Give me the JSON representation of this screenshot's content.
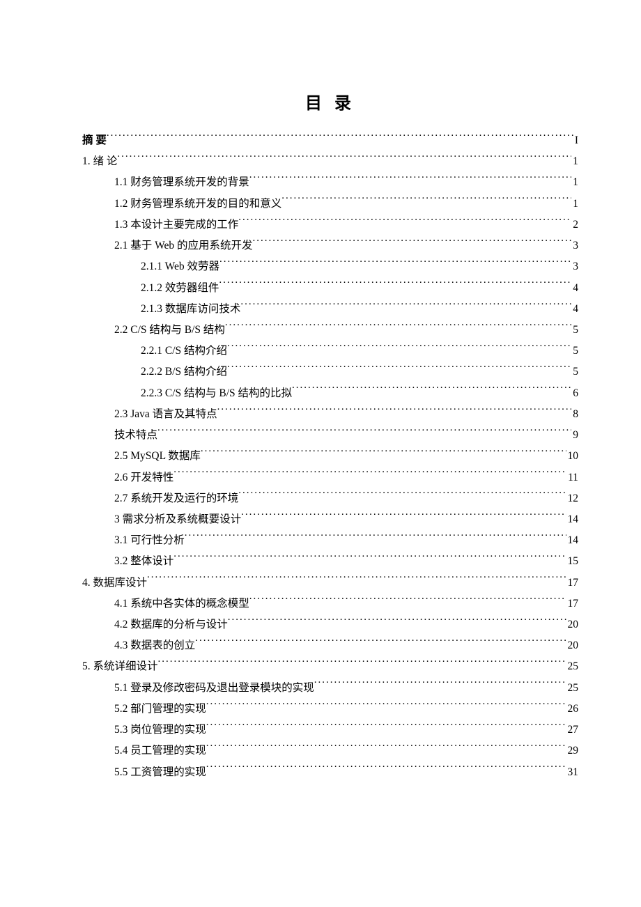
{
  "title": "目 录",
  "toc": [
    {
      "label": "摘 要",
      "page": "I",
      "indent": "indent-0",
      "bold": true
    },
    {
      "label": "1.  绪   论",
      "page": "1",
      "indent": "indent-0"
    },
    {
      "label": "1.1  财务管理系统开发的背景",
      "page": "1",
      "indent": "indent-2"
    },
    {
      "label": "1.2  财务管理系统开发的目的和意义",
      "page": "1",
      "indent": "indent-2"
    },
    {
      "label": "1.3  本设计主要完成的工作",
      "page": "2",
      "indent": "indent-2"
    },
    {
      "label": "2.1  基于 Web 的应用系统开发",
      "page": "3",
      "indent": "indent-2"
    },
    {
      "label": "2.1.1  Web 效劳器",
      "page": "3",
      "indent": "indent-3"
    },
    {
      "label": "2.1.2  效劳器组件",
      "page": "4",
      "indent": "indent-3"
    },
    {
      "label": "2.1.3  数据库访问技术",
      "page": "4",
      "indent": "indent-3"
    },
    {
      "label": "2.2  C/S 结构与 B/S 结构",
      "page": "5",
      "indent": "indent-2"
    },
    {
      "label": "2.2.1  C/S 结构介绍",
      "page": "5",
      "indent": "indent-3"
    },
    {
      "label": "2.2.2  B/S 结构介绍",
      "page": "5",
      "indent": "indent-3"
    },
    {
      "label": "2.2.3  C/S 结构与 B/S 结构的比拟",
      "page": "6",
      "indent": "indent-3"
    },
    {
      "label": "2.3 Java 语言及其特点",
      "page": "8",
      "indent": "indent-2"
    },
    {
      "label": "技术特点",
      "page": "9",
      "indent": "indent-2"
    },
    {
      "label": "2.5 MySQL 数据库",
      "page": "10",
      "indent": "indent-2"
    },
    {
      "label": "2.6 开发特性",
      "page": "11",
      "indent": "indent-2"
    },
    {
      "label": "2.7 系统开发及运行的环境",
      "page": "12",
      "indent": "indent-2"
    },
    {
      "label": "3  需求分析及系统概要设计",
      "page": "14",
      "indent": "indent-2"
    },
    {
      "label": "3.1  可行性分析",
      "page": "14",
      "indent": "indent-2"
    },
    {
      "label": "3.2  整体设计",
      "page": "15",
      "indent": "indent-2"
    },
    {
      "label": "4.  数据库设计",
      "page": "17",
      "indent": "indent-0"
    },
    {
      "label": "4.1  系统中各实体的概念模型",
      "page": "17",
      "indent": "indent-2"
    },
    {
      "label": "4.2  数据库的分析与设计",
      "page": "20",
      "indent": "indent-2"
    },
    {
      "label": "4.3  数据表的创立",
      "page": "20",
      "indent": "indent-2"
    },
    {
      "label": "5.  系统详细设计",
      "page": "25",
      "indent": "indent-0"
    },
    {
      "label": "5.1  登录及修改密码及退出登录模块的实现",
      "page": "25",
      "indent": "indent-2"
    },
    {
      "label": "5.2  部门管理的实现",
      "page": "26",
      "indent": "indent-2"
    },
    {
      "label": "5.3  岗位管理的实现",
      "page": "27",
      "indent": "indent-2"
    },
    {
      "label": "5.4  员工管理的实现",
      "page": "29",
      "indent": "indent-2"
    },
    {
      "label": "5.5  工资管理的实现",
      "page": "31",
      "indent": "indent-2"
    }
  ]
}
